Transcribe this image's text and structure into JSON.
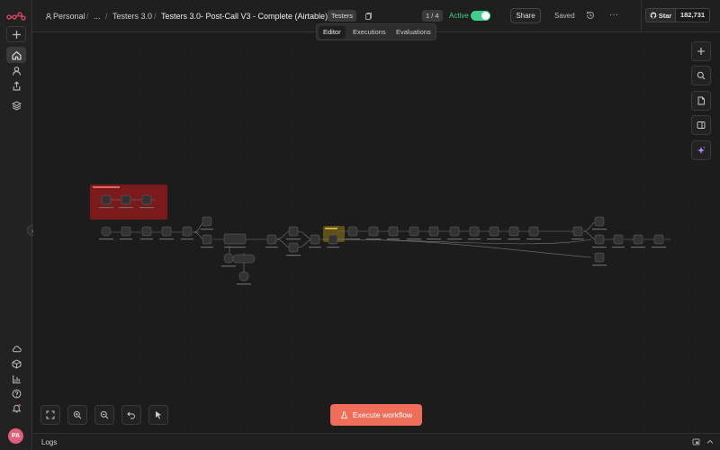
{
  "app": {
    "logo_icon": "n8n-logo-icon",
    "avatar_initials": "PA"
  },
  "sidebar": {
    "top_items": [
      {
        "icon": "plus-icon"
      },
      {
        "icon": "home-icon"
      },
      {
        "icon": "user-icon"
      },
      {
        "icon": "share-icon"
      },
      {
        "icon": "layers-icon"
      }
    ],
    "bottom_items": [
      {
        "icon": "cloud-icon"
      },
      {
        "icon": "box-icon"
      },
      {
        "icon": "chart-icon"
      },
      {
        "icon": "help-icon"
      },
      {
        "icon": "bell-icon"
      }
    ]
  },
  "breadcrumb": {
    "personal": "Personal",
    "ellipsis": "...",
    "folder": "Testers 3.0",
    "workflow": "Testers 3.0- Post-Call V3 - Complete (Airtable)"
  },
  "header": {
    "tag": "Testers",
    "counter": "1 / 4",
    "active_label": "Active",
    "share_label": "Share",
    "saved_label": "Saved",
    "star_label": "Star",
    "star_count": "182,731"
  },
  "tabs": [
    {
      "label": "Editor",
      "active": true
    },
    {
      "label": "Executions",
      "active": false
    },
    {
      "label": "Evaluations",
      "active": false
    }
  ],
  "canvas": {
    "sticky_red": {
      "color": "#8b1a1a"
    },
    "sticky_yellow": {
      "color": "#6b5a12"
    }
  },
  "execute_button": {
    "label": "Execute workflow"
  },
  "logs": {
    "label": "Logs"
  },
  "colors": {
    "accent": "#ef6e5a",
    "active": "#3fcf8e",
    "ai": "#b68cff"
  }
}
